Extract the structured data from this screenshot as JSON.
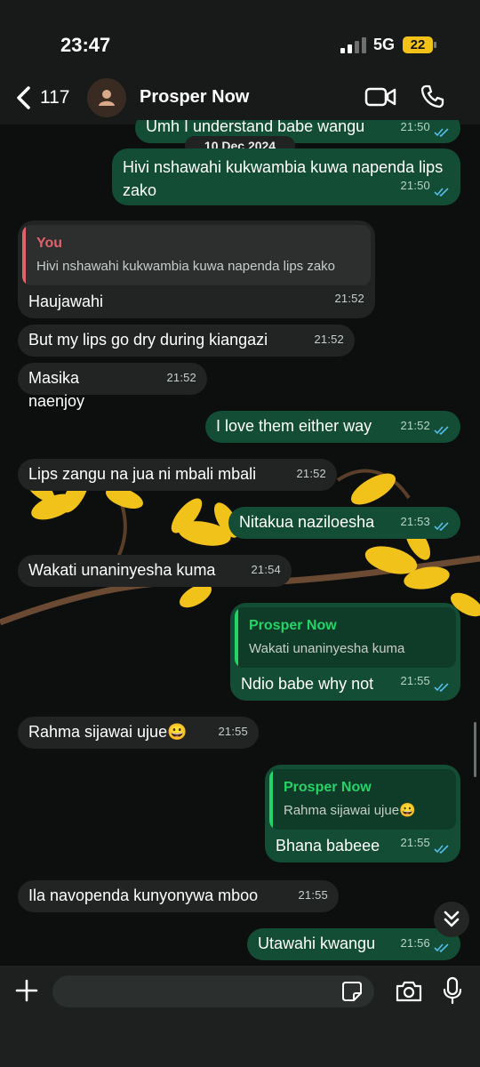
{
  "status_bar": {
    "time": "23:47",
    "network": "5G",
    "battery": "22"
  },
  "header": {
    "back_count": "117",
    "contact_name": "Prosper Now"
  },
  "date_separator": "10 Dec 2024",
  "messages": [
    {
      "dir": "out",
      "text": "Umh I understand babe wangu",
      "time": "21:50"
    },
    {
      "dir": "out",
      "text": "Hivi nshawahi kukwambia kuwa napenda lips zako",
      "time": "21:50"
    },
    {
      "dir": "in",
      "quote_name": "You",
      "quote_text": "Hivi nshawahi kukwambia kuwa napenda lips zako",
      "text": "Haujawahi",
      "time": "21:52"
    },
    {
      "dir": "in",
      "text": "But my lips go dry during kiangazi",
      "time": "21:52"
    },
    {
      "dir": "in",
      "text": "Masika naenjoy",
      "time": "21:52"
    },
    {
      "dir": "out",
      "text": "I love them either way",
      "time": "21:52"
    },
    {
      "dir": "in",
      "text": "Lips zangu na jua ni mbali mbali",
      "time": "21:52"
    },
    {
      "dir": "out",
      "text": "Nitakua naziloesha",
      "time": "21:53"
    },
    {
      "dir": "in",
      "text": "Wakati unaninyesha kuma",
      "time": "21:54"
    },
    {
      "dir": "out",
      "quote_name": "Prosper Now",
      "quote_text": "Wakati unaninyesha kuma",
      "text": "Ndio babe why not",
      "time": "21:55"
    },
    {
      "dir": "in",
      "text": "Rahma sijawai ujue😀",
      "time": "21:55"
    },
    {
      "dir": "out",
      "quote_name": "Prosper Now",
      "quote_text": "Rahma sijawai ujue😀",
      "text": "Bhana babeee",
      "time": "21:55"
    },
    {
      "dir": "in",
      "text": "Ila navopenda kunyonywa mboo",
      "time": "21:55"
    },
    {
      "dir": "out",
      "text": "Utawahi kwangu",
      "time": "21:56"
    }
  ],
  "input": {
    "value": "",
    "placeholder": ""
  },
  "colors": {
    "incoming": "#212423",
    "outgoing": "#134d35",
    "quote_you": "#e2616b",
    "quote_contact": "#25d366",
    "ticks": "#53bdeb",
    "battery": "#f2c21b"
  },
  "icons": [
    "chevron-left-icon",
    "person-icon",
    "video-call-icon",
    "phone-icon",
    "plus-icon",
    "sticker-icon",
    "camera-icon",
    "microphone-icon",
    "double-chevron-down-icon",
    "double-check-icon"
  ]
}
